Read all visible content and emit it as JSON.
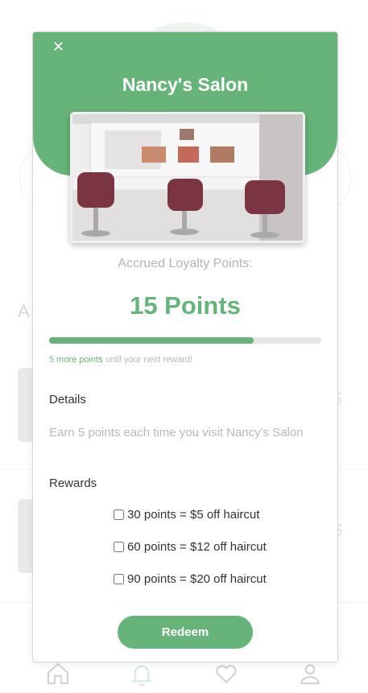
{
  "modal": {
    "close_label": "✕",
    "title": "Nancy's Salon",
    "accrued_label": "Accrued Loyalty Points:",
    "points_value": "15 Points",
    "progress_fraction": 0.75,
    "next_reward_highlight": "5 more points",
    "next_reward_rest": " until your next reward!",
    "details_heading": "Details",
    "details_text": "Earn 5 points each time you visit Nancy's Salon",
    "rewards_heading": "Rewards",
    "rewards": [
      {
        "label": "30 points = $5 off haircut",
        "checked": false
      },
      {
        "label": "60 points = $12 off haircut",
        "checked": false
      },
      {
        "label": "90 points = $20 off haircut",
        "checked": false
      }
    ],
    "redeem_label": "Redeem"
  },
  "background": {
    "heading_fragment": "A",
    "price_fragment": "$"
  },
  "bottom_nav": [
    "home-icon",
    "bell-icon",
    "heart-icon",
    "user-icon"
  ],
  "colors": {
    "accent": "#67b47a",
    "muted_text": "#b8b8b8",
    "track": "#e6e6e6"
  }
}
